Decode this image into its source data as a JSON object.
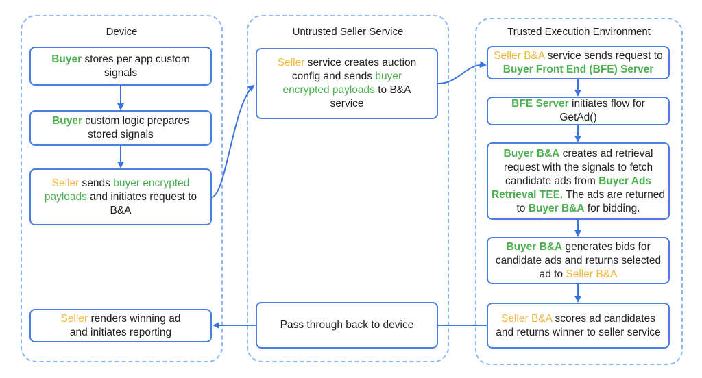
{
  "colors": {
    "lane_border": "#8ab8f5",
    "box_border": "#4a7fe0",
    "arrow": "#3b74e0",
    "buyer_green": "#4caf50",
    "seller_yellow": "#f0b63e",
    "text": "#202124"
  },
  "lanes": [
    {
      "title": "Device"
    },
    {
      "title": "Untrusted Seller Service"
    },
    {
      "title": "Trusted Execution Environment"
    }
  ],
  "device": {
    "boxes": [
      {
        "segments": [
          {
            "text": "Buyer",
            "role": "buyer"
          },
          {
            "text": " stores per app custom signals",
            "role": "plain"
          }
        ]
      },
      {
        "segments": [
          {
            "text": "Buyer",
            "role": "buyer"
          },
          {
            "text": " custom logic prepares stored signals",
            "role": "plain"
          }
        ]
      },
      {
        "segments": [
          {
            "text": "Seller",
            "role": "seller"
          },
          {
            "text": " sends ",
            "role": "plain"
          },
          {
            "text": "buyer encrypted payloads",
            "role": "buyer-light"
          },
          {
            "text": " and initiates request to B&A",
            "role": "plain"
          }
        ]
      },
      {
        "segments": [
          {
            "text": "Seller",
            "role": "seller"
          },
          {
            "text": " renders winning ad and initiates reporting",
            "role": "plain"
          }
        ]
      }
    ]
  },
  "seller": {
    "boxes": [
      {
        "segments": [
          {
            "text": "Seller",
            "role": "seller"
          },
          {
            "text": " service creates auction config and sends ",
            "role": "plain"
          },
          {
            "text": "buyer encrypted payloads",
            "role": "buyer-light"
          },
          {
            "text": " to B&A service",
            "role": "plain"
          }
        ]
      },
      {
        "segments": [
          {
            "text": "Pass through back to device",
            "role": "plain"
          }
        ]
      }
    ]
  },
  "tee": {
    "boxes": [
      {
        "segments": [
          {
            "text": "Seller B&A",
            "role": "seller"
          },
          {
            "text": " service sends request to ",
            "role": "plain"
          },
          {
            "text": "Buyer Front End (BFE) Server",
            "role": "buyer"
          }
        ]
      },
      {
        "segments": [
          {
            "text": "BFE Server",
            "role": "buyer"
          },
          {
            "text": " initiates flow for GetAd()",
            "role": "plain"
          }
        ]
      },
      {
        "segments": [
          {
            "text": "Buyer B&A",
            "role": "buyer"
          },
          {
            "text": " creates ad retrieval request with the signals to fetch candidate ads from ",
            "role": "plain"
          },
          {
            "text": "Buyer Ads Retrieval TEE.",
            "role": "buyer"
          },
          {
            "text": " The ads are returned to ",
            "role": "plain"
          },
          {
            "text": "Buyer B&A",
            "role": "buyer"
          },
          {
            "text": " for bidding.",
            "role": "plain"
          }
        ]
      },
      {
        "segments": [
          {
            "text": "Buyer B&A",
            "role": "buyer"
          },
          {
            "text": "  generates bids for candidate ads and returns selected ad to ",
            "role": "plain"
          },
          {
            "text": "Seller B&A",
            "role": "seller"
          }
        ]
      },
      {
        "segments": [
          {
            "text": "Seller B&A",
            "role": "seller"
          },
          {
            "text": " scores ad candidates and returns winner to seller service",
            "role": "plain"
          }
        ]
      }
    ]
  }
}
